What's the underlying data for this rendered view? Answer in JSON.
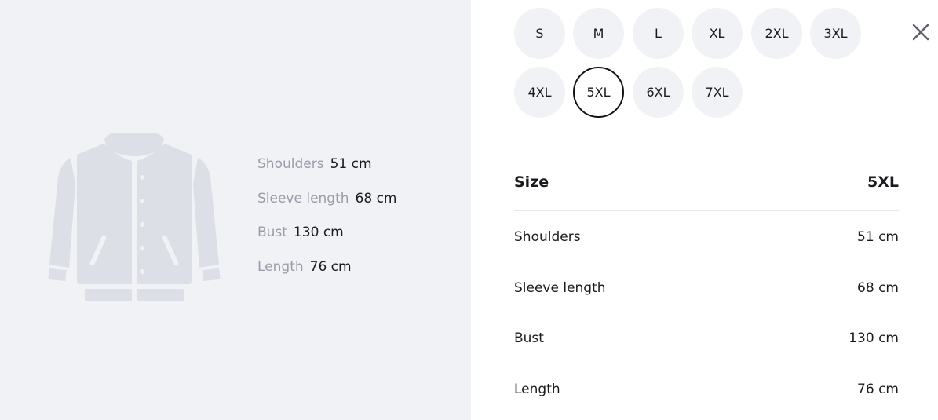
{
  "panel": {
    "illustration_icon": "jacket-icon",
    "measurements": [
      {
        "label": "Shoulders",
        "value": "51 cm"
      },
      {
        "label": "Sleeve length",
        "value": "68 cm"
      },
      {
        "label": "Bust",
        "value": "130 cm"
      },
      {
        "label": "Length",
        "value": "76 cm"
      }
    ]
  },
  "sizes": {
    "options": [
      "S",
      "M",
      "L",
      "XL",
      "2XL",
      "3XL",
      "4XL",
      "5XL",
      "6XL",
      "7XL"
    ],
    "selected": "5XL"
  },
  "close_icon": "close-icon",
  "table": {
    "header_label": "Size",
    "header_value": "5XL",
    "rows": [
      {
        "label": "Shoulders",
        "value": "51 cm"
      },
      {
        "label": "Sleeve length",
        "value": "68 cm"
      },
      {
        "label": "Bust",
        "value": "130 cm"
      },
      {
        "label": "Length",
        "value": "76 cm"
      }
    ]
  },
  "colors": {
    "panel_bg": "#f1f2f6",
    "illustration": "#dddfe7",
    "selected_border": "#111111",
    "muted_text": "#9b9ca8"
  }
}
